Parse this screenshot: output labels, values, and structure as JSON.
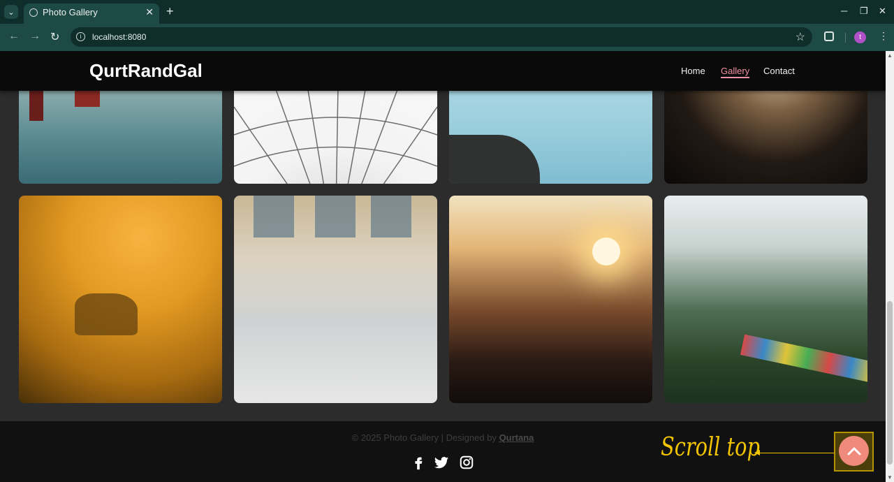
{
  "browser": {
    "tab_title": "Photo Gallery",
    "url": "localhost:8080",
    "profile_initial": "t"
  },
  "site": {
    "logo": "QurtRandGal",
    "nav": [
      {
        "label": "Home",
        "active": false
      },
      {
        "label": "Gallery",
        "active": true
      },
      {
        "label": "Contact",
        "active": false
      }
    ]
  },
  "gallery": {
    "photos": [
      {
        "subject": "golden-gate-bridge"
      },
      {
        "subject": "ceiling-lines"
      },
      {
        "subject": "blue-lagoon"
      },
      {
        "subject": "concert-crowd"
      },
      {
        "subject": "deer-in-fog"
      },
      {
        "subject": "grand-central-terminal"
      },
      {
        "subject": "sunset-city-train"
      },
      {
        "subject": "mountain-prayer-flags"
      }
    ]
  },
  "footer": {
    "copyright_prefix": "© 2025 Photo Gallery | Designed by",
    "designer": "Qurtana",
    "social_icons": [
      "facebook-icon",
      "twitter-icon",
      "instagram-icon"
    ]
  },
  "annotation": {
    "label": "Scroll top"
  },
  "colors": {
    "accent_pink": "#f08fa8",
    "scroll_button": "#f08a7c",
    "annotation": "#f2c500",
    "header_bg": "#0a0a0a",
    "chrome_bg": "#1e4a45"
  }
}
